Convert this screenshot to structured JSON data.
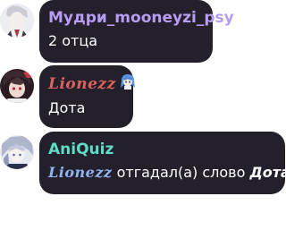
{
  "messages": [
    {
      "author": "Мудри_mooneyzi_psy",
      "author_color": "#b89cf3",
      "text": "2 отца"
    },
    {
      "author": "Lionezz",
      "author_color": "#d9625f",
      "author_emoji": "anime-girl-emoji",
      "text": "Дота"
    },
    {
      "author": "AniQuiz",
      "author_color": "#5fdcc4",
      "mention": "Lionezz",
      "mention_color": "#8fb4f2",
      "text_middle": "отгадал(а) слово",
      "answer": "Дота"
    }
  ],
  "colors": {
    "background": "#ffffff",
    "bubble": "#23202c",
    "text": "#ffffff"
  }
}
